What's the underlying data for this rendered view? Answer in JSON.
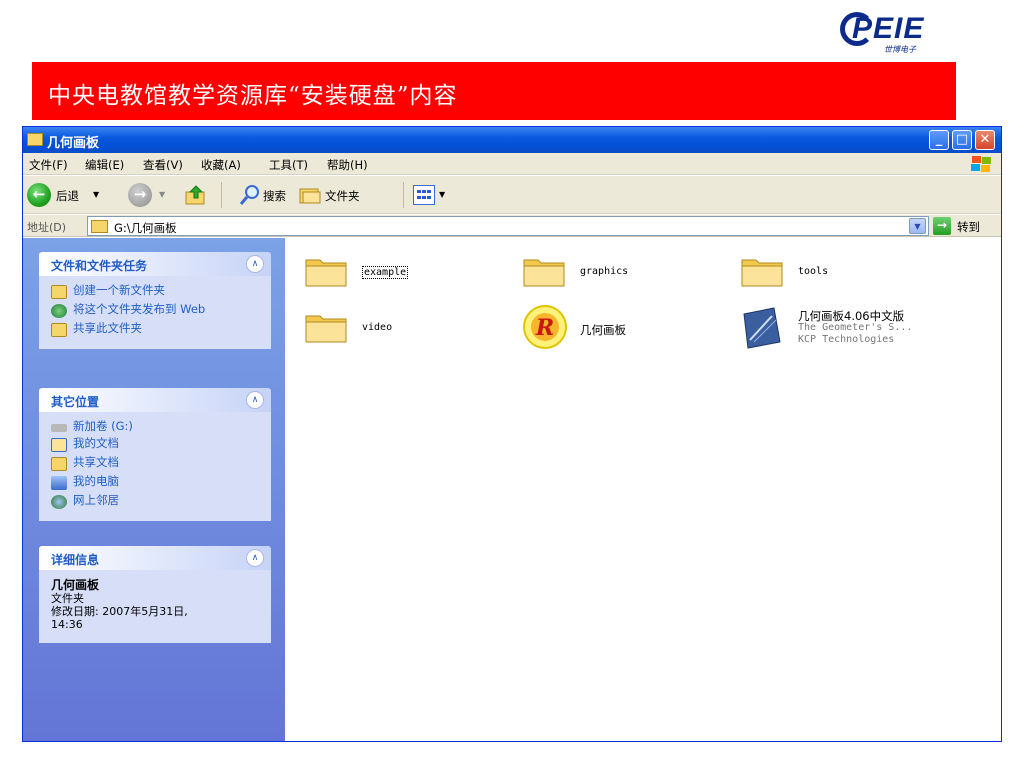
{
  "logo": {
    "text": "PEIE",
    "subtext": "世博电子"
  },
  "banner": {
    "text": "中央电教馆教学资源库“安装硬盘”内容"
  },
  "window": {
    "title": "几何画板",
    "controls": {
      "minimize": "_",
      "maximize": "□",
      "close": "✕"
    }
  },
  "menu": {
    "file": "文件(F)",
    "edit": "编辑(E)",
    "view": "查看(V)",
    "favorites": "收藏(A)",
    "tools": "工具(T)",
    "help": "帮助(H)"
  },
  "toolbar": {
    "back_label": "后退",
    "search_label": "搜索",
    "folders_label": "文件夹"
  },
  "address": {
    "label": "地址(D)",
    "value": "G:\\几何画板",
    "go_label": "转到"
  },
  "tasks_panel": {
    "title": "文件和文件夹任务",
    "items": [
      {
        "label": "创建一个新文件夹",
        "icon": "new-folder-icon"
      },
      {
        "label": "将这个文件夹发布到 Web",
        "icon": "publish-web-icon"
      },
      {
        "label": "共享此文件夹",
        "icon": "share-folder-icon"
      }
    ]
  },
  "places_panel": {
    "title": "其它位置",
    "items": [
      {
        "label": "新加卷 (G:)",
        "icon": "drive-icon"
      },
      {
        "label": "我的文档",
        "icon": "my-documents-icon"
      },
      {
        "label": "共享文档",
        "icon": "shared-documents-icon"
      },
      {
        "label": "我的电脑",
        "icon": "my-computer-icon"
      },
      {
        "label": "网上邻居",
        "icon": "network-places-icon"
      }
    ]
  },
  "details_panel": {
    "title": "详细信息",
    "name": "几何画板",
    "type": "文件夹",
    "modified_label": "修改日期: 2007年5月31日,",
    "modified_time": "14:36"
  },
  "files": [
    {
      "name": "example",
      "kind": "folder",
      "selected": true
    },
    {
      "name": "graphics",
      "kind": "folder"
    },
    {
      "name": "tools",
      "kind": "folder"
    },
    {
      "name": "video",
      "kind": "folder"
    },
    {
      "name": "几何画板",
      "kind": "shortcut"
    },
    {
      "name": "几何画板4.06中文版",
      "kind": "installer",
      "line2": "The Geometer's S...",
      "line3": "KCP Technologies"
    }
  ],
  "colors": {
    "banner": "#ff0000",
    "titlebar": "#0a5ae0",
    "task_link": "#215dc6",
    "left_pane": "#6f8de0"
  }
}
